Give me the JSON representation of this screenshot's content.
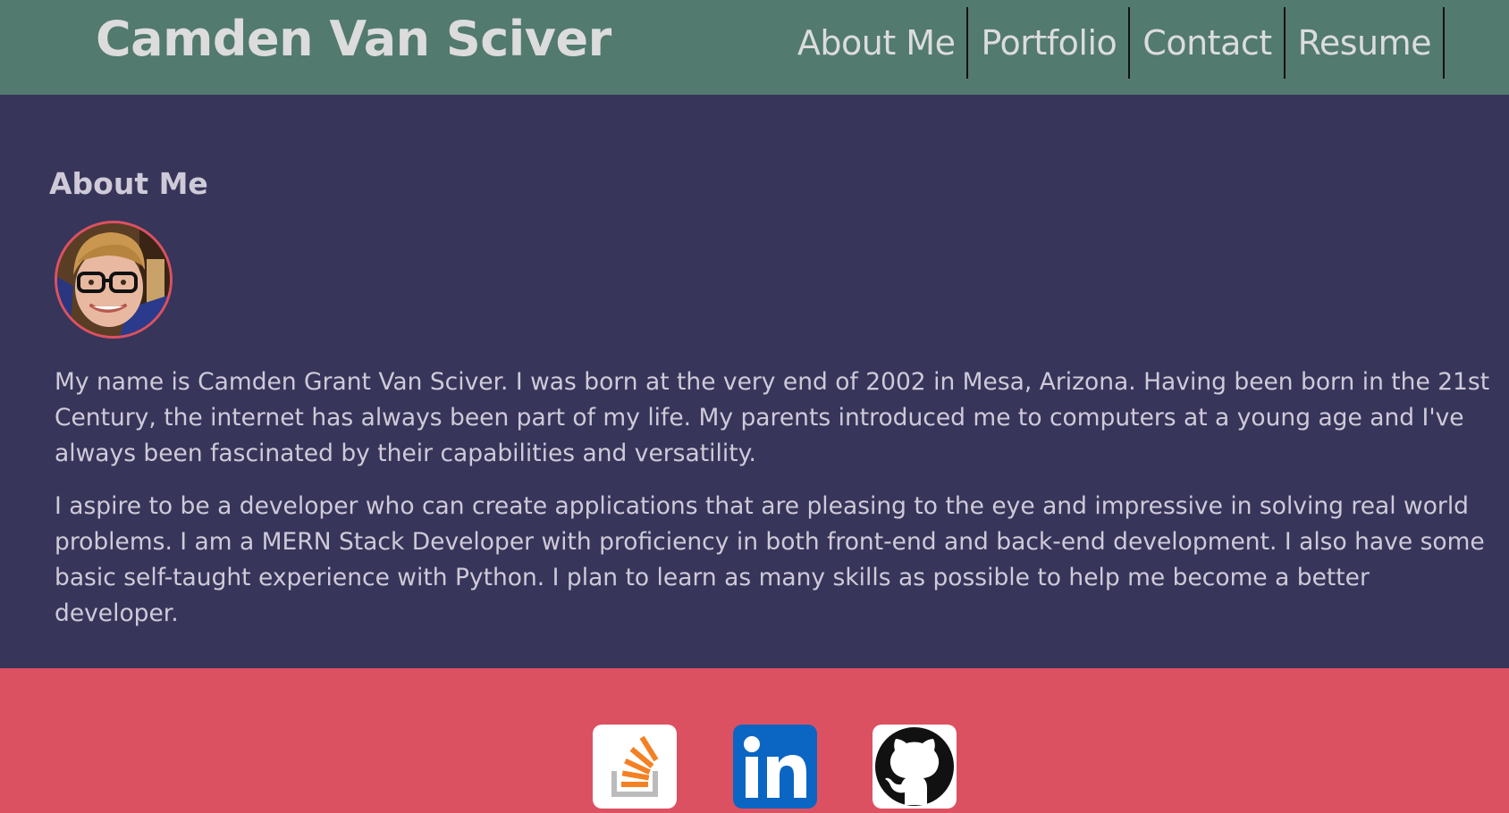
{
  "header": {
    "title": "Camden Van Sciver",
    "background": "#527a6f",
    "nav": [
      {
        "label": "About Me"
      },
      {
        "label": "Portfolio"
      },
      {
        "label": "Contact"
      },
      {
        "label": "Resume"
      }
    ]
  },
  "main": {
    "heading": "About Me",
    "avatar_icon": "profile-photo",
    "paragraphs": [
      "My name is Camden Grant Van Sciver. I was born at the very end of 2002 in Mesa, Arizona. Having been born in the 21st Century, the internet has always been part of my life. My parents introduced me to computers at a young age and I've always been fascinated by their capabilities and versatility.",
      "I aspire to be a developer who can create applications that are pleasing to the eye and impressive in solving real world problems. I am a MERN Stack Developer with proficiency in both front-end and back-end development. I also have some basic self-taught experience with Python. I plan to learn as many skills as possible to help me become a better developer."
    ],
    "background": "#37355a"
  },
  "footer": {
    "background": "#dc5162",
    "links": [
      {
        "icon": "stackoverflow-icon"
      },
      {
        "icon": "linkedin-icon"
      },
      {
        "icon": "github-icon"
      }
    ]
  },
  "colors": {
    "accent": "#dc5162",
    "text": "#cfcad8",
    "header_text": "#dcdcdc"
  }
}
